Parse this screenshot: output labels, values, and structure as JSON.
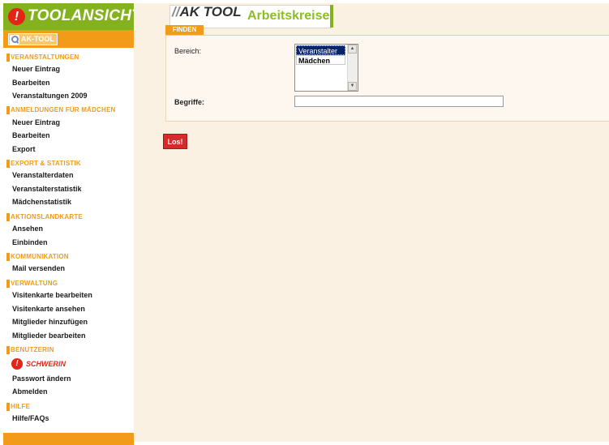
{
  "brand": {
    "title": "TOOLANSICHT",
    "badge": "!"
  },
  "aktool_button": {
    "label": "AK-TOOL",
    "icon": "search-icon"
  },
  "sidebar": {
    "sections": [
      {
        "title": "VERANSTALTUNGEN",
        "items": [
          "Neuer Eintrag",
          "Bearbeiten",
          "Veranstaltungen 2009"
        ]
      },
      {
        "title": "ANMELDUNGEN FÜR MÄDCHEN",
        "items": [
          "Neuer Eintrag",
          "Bearbeiten",
          "Export"
        ]
      },
      {
        "title": "EXPORT & STATISTIK",
        "items": [
          "Veranstalterdaten",
          "Veranstalterstatistik",
          "Mädchenstatistik"
        ]
      },
      {
        "title": "AKTIONSLANDKARTE",
        "items": [
          "Ansehen",
          "Einbinden"
        ]
      },
      {
        "title": "KOMMUNIKATION",
        "items": [
          "Mail versenden"
        ]
      },
      {
        "title": "VERWALTUNG",
        "items": [
          "Visitenkarte bearbeiten",
          "Visitenkarte ansehen",
          "Mitglieder hinzufügen",
          "Mitglieder bearbeiten"
        ]
      },
      {
        "title": "BENUTZERIN",
        "user": "SCHWERIN",
        "items": [
          "Passwort ändern",
          "Abmelden"
        ]
      },
      {
        "title": "HILFE",
        "items": [
          "Hilfe/FAQs"
        ]
      }
    ]
  },
  "logo": {
    "ak": "AK TOOL",
    "slash": "//",
    "arbeitskreise": "Arbeitskreise"
  },
  "tab": {
    "label": "FINDEN"
  },
  "form": {
    "bereich_label": "Bereich:",
    "begriffe_label": "Begriffe:",
    "bereich_options": [
      "Veranstalter",
      "Mädchen"
    ],
    "bereich_selected": "Veranstalter",
    "begriffe_value": ""
  },
  "submit": {
    "label": "Los!"
  },
  "colors": {
    "green": "#83b21e",
    "orange": "#f29b19",
    "red": "#d42b2b",
    "cream": "#fbf1e3"
  }
}
